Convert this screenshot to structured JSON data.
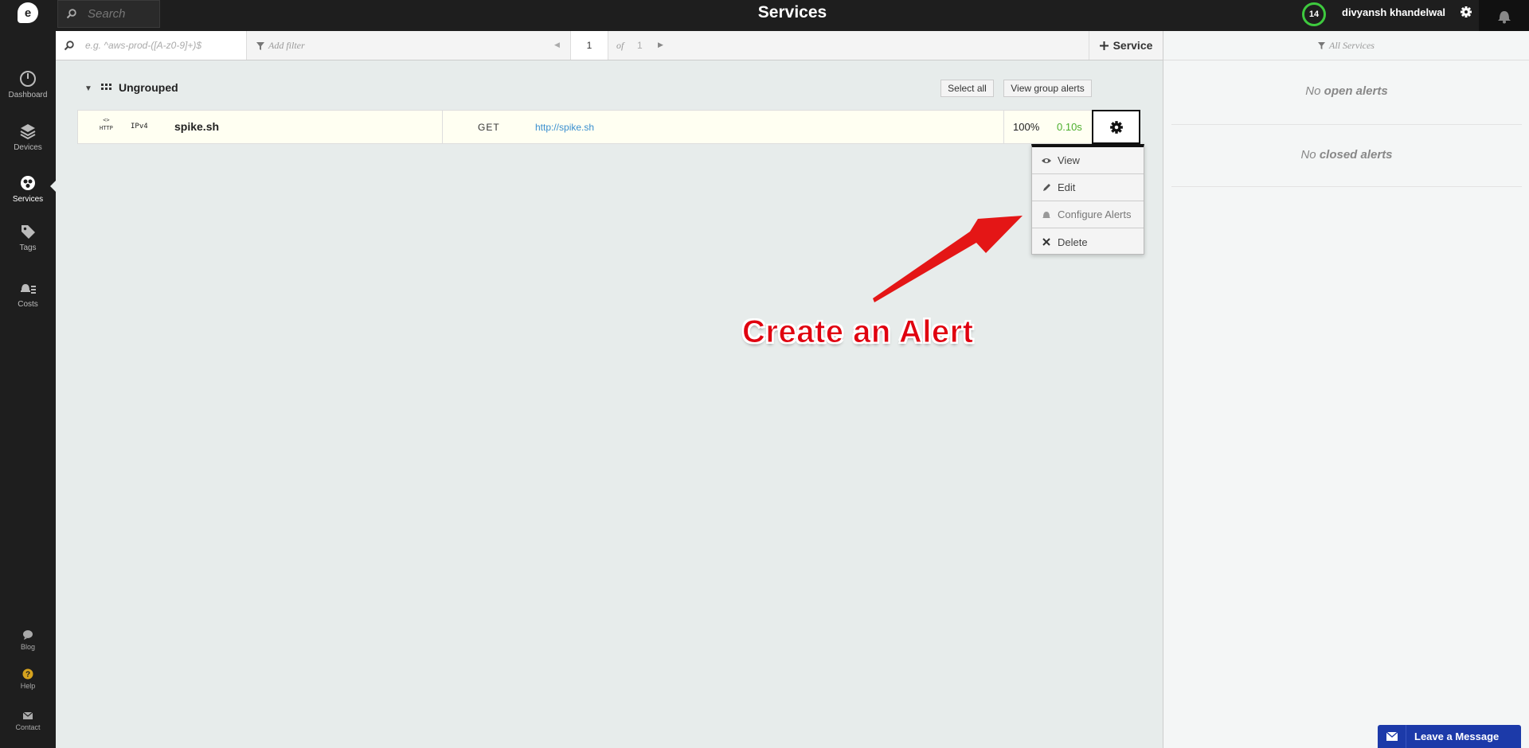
{
  "sidebar": {
    "logo": "e",
    "items": [
      {
        "label": "Dashboard",
        "icon": "dashboard-icon"
      },
      {
        "label": "Devices",
        "icon": "layers-icon"
      },
      {
        "label": "Services",
        "icon": "services-icon"
      },
      {
        "label": "Tags",
        "icon": "tag-icon"
      },
      {
        "label": "Costs",
        "icon": "costs-icon"
      }
    ],
    "bottom": [
      {
        "label": "Blog",
        "icon": "chat-bubble-icon"
      },
      {
        "label": "Help",
        "icon": "help-icon"
      },
      {
        "label": "Contact",
        "icon": "envelope-icon"
      }
    ],
    "active": "Services"
  },
  "topbar": {
    "search_placeholder": "Search",
    "title": "Services",
    "alert_count": "14",
    "username": "divyansh khandelwal"
  },
  "filterbar": {
    "regex_placeholder": "e.g. ^aws-prod-([A-z0-9]+)$",
    "add_filter": "Add filter",
    "page_current": "1",
    "page_of": "of",
    "page_total": "1",
    "add_service": "Service"
  },
  "right_panel": {
    "header": "All Services",
    "open_prefix": "No",
    "open_bold": "open alerts",
    "closed_prefix": "No",
    "closed_bold": "closed alerts"
  },
  "group": {
    "name": "Ungrouped",
    "select_all": "Select all",
    "view_group_alerts": "View group alerts"
  },
  "service": {
    "type_code": "<>",
    "type_label": "HTTP",
    "ip_version": "IPv4",
    "name": "spike.sh",
    "method": "GET",
    "url": "http://spike.sh",
    "uptime": "100%",
    "response_time": "0.10s"
  },
  "dropdown": {
    "items": [
      {
        "label": "View",
        "icon": "eye-icon"
      },
      {
        "label": "Edit",
        "icon": "pencil-icon"
      },
      {
        "label": "Configure Alerts",
        "icon": "bell-icon"
      },
      {
        "label": "Delete",
        "icon": "close-icon"
      }
    ]
  },
  "annotation": {
    "text": "Create an Alert",
    "color": "#e0000f"
  },
  "chat_widget": {
    "label": "Leave a Message",
    "color": "#1c3aa9"
  },
  "colors": {
    "sidebar_bg": "#1e1e1e",
    "content_bg": "#e7eceb",
    "badge_ring": "#3ec93e",
    "link": "#3a8fcf",
    "response_ok": "#4cae2c"
  }
}
